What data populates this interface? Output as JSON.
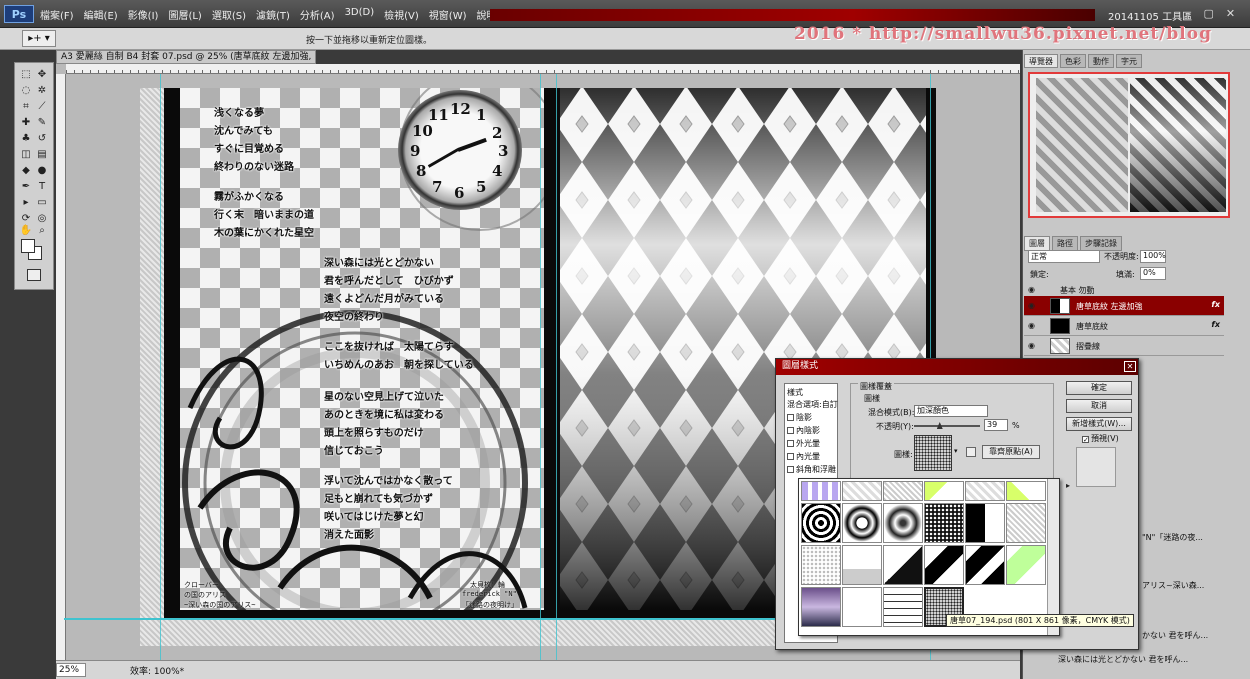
{
  "app": {
    "logo": "Ps",
    "menu": [
      "檔案(F)",
      "編輯(E)",
      "影像(I)",
      "圖層(L)",
      "選取(S)",
      "濾鏡(T)",
      "分析(A)",
      "3D(D)",
      "檢視(V)",
      "視窗(W)",
      "說明(H)"
    ],
    "workspace": "20141105 工具區",
    "window_buttons": [
      "–",
      "▢",
      "✕"
    ]
  },
  "options": {
    "tool_preset": "▸+ ▾",
    "hint": "按一下並拖移以重新定位圖樣。"
  },
  "watermark": "2016 * http://smallwu36.pixnet.net/blog",
  "document": {
    "tab": "A3 愛麗絲 自制 B4 封套 07.psd @ 25% (唐草底紋 左邊加強, RGB/8) *",
    "zoom": "25%",
    "status": "效率: 100%*"
  },
  "poem": [
    "浅くなる夢",
    "沈んでみても",
    "すぐに目覚める",
    "終わりのない迷路",
    "霧がふかくなる",
    "行く末　暗いままの道",
    "木の葉にかくれた星空",
    "深い森には光とどかない",
    "君を呼んだとして　ひびかず",
    "遠くよどんだ月がみている",
    "夜空の終わり",
    "ここを抜ければ　太陽てらす",
    "いちめんのあお　朝を探している",
    "星のない空見上げて泣いた",
    "あのときを境に私は変わる",
    "頭上を照らすものだけ",
    "信じておこう",
    "浮いて沈んではかなく散って",
    "足もと崩れても気づかず",
    "咲いてはじけた夢と幻",
    "消えた面影"
  ],
  "credits": {
    "left": [
      "クローバー",
      "の国のアリス",
      "~深い森の国のアリス~"
    ],
    "right": [
      "太貝枚：輪",
      "frederick \"N\"",
      "「迷路の夜明け」"
    ]
  },
  "clock_numbers": [
    "12",
    "1",
    "2",
    "3",
    "4",
    "5",
    "6",
    "7",
    "8",
    "9",
    "10",
    "11"
  ],
  "panels": {
    "navigator_tabs": [
      "導覽器",
      "色彩",
      "動作",
      "字元"
    ],
    "layers_tabs": [
      "圖層",
      "路徑",
      "步驟記錄"
    ],
    "blend_mode": "正常",
    "opacity_label": "不透明度:",
    "opacity_value": "100%",
    "lock_label": "鎖定:",
    "fill_label": "填滿:",
    "fill_value": "0%",
    "layers": [
      {
        "name": "基本 勿動",
        "fx": "",
        "group": true
      },
      {
        "name": "唐草底紋 左邊加強",
        "fx": "fx",
        "selected": true
      },
      {
        "name": "唐草底紋",
        "fx": "fx"
      },
      {
        "name": "摺疊線",
        "fx": ""
      }
    ],
    "side_texts": [
      "\"N\"「迷路の夜...",
      "アリス~深い森...",
      "かない 君を呼ん...",
      "深い森には光とどかない 君を呼ん..."
    ]
  },
  "dialog": {
    "title": "圖層樣式",
    "close": "✕",
    "style_list": [
      {
        "label": "樣式",
        "check": false
      },
      {
        "label": "混合選項:自訂",
        "check": false
      },
      {
        "label": "陰影",
        "check": true
      },
      {
        "label": "內陰影",
        "check": true
      },
      {
        "label": "外光暈",
        "check": true
      },
      {
        "label": "內光暈",
        "check": true
      },
      {
        "label": "斜角和浮雕",
        "check": true
      }
    ],
    "section": "圖樣覆蓋",
    "subsection": "圖樣",
    "blend_label": "混合模式(B):",
    "blend_value": "加深顏色",
    "opacity_label": "不透明(Y):",
    "opacity_value": "39",
    "opacity_value_num": 39,
    "opacity_unit": "%",
    "pattern_label": "圖樣:",
    "snap_origin": "靠齊原點(A)",
    "buttons": [
      "確定",
      "取消",
      "新增樣式(W)..."
    ],
    "preview": "預視(V)",
    "tooltip": "唐草07_194.psd (801 X 861 像素，CMYK 模式)"
  }
}
